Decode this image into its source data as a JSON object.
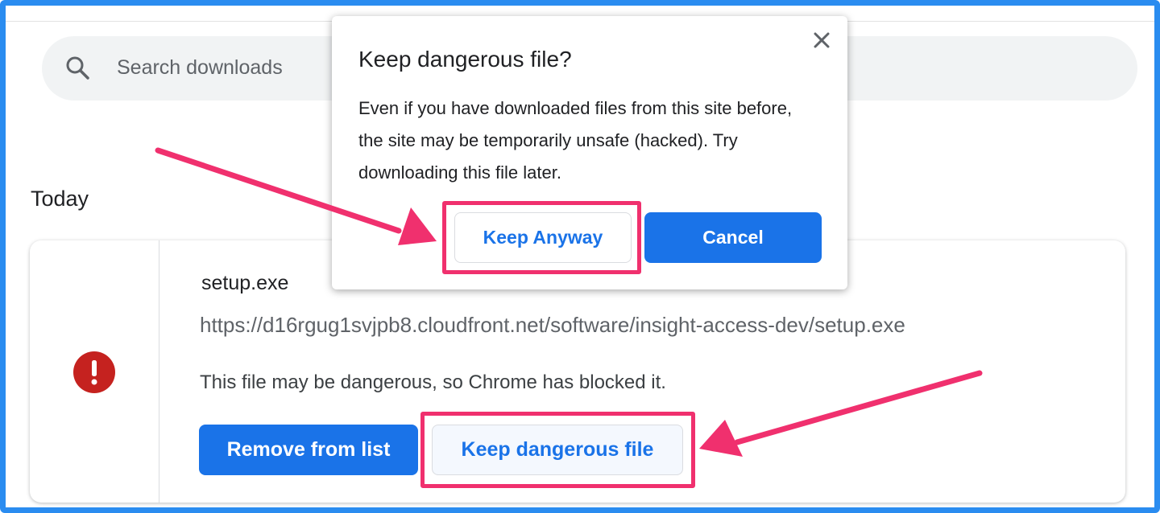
{
  "search": {
    "placeholder": "Search downloads",
    "icon": "search-icon"
  },
  "section": {
    "title": "Today"
  },
  "download": {
    "file_name": "setup.exe",
    "url": "https://d16rgug1svjpb8.cloudfront.net/software/insight-access-dev/setup.exe",
    "status": "This file may be dangerous, so Chrome has blocked it.",
    "remove_label": "Remove from list",
    "keep_label": "Keep dangerous file",
    "icon": "danger-icon"
  },
  "dialog": {
    "title": "Keep dangerous file?",
    "body": "Even if you have downloaded files from this site before, the site may be temporarily unsafe (hacked). Try downloading this file later.",
    "keep_anyway_label": "Keep Anyway",
    "cancel_label": "Cancel"
  },
  "colors": {
    "accent": "#1a73e8",
    "danger": "#c5221f",
    "annotation": "#f0306e",
    "frame": "#2a8cf0"
  }
}
